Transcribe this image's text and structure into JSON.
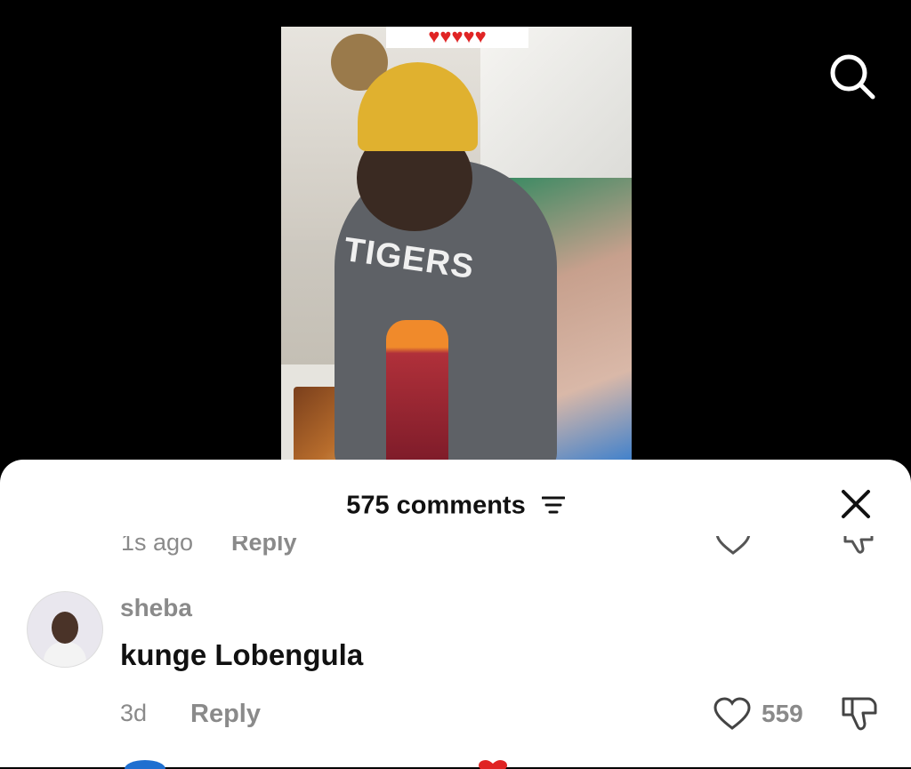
{
  "video": {
    "reaction_hearts": "♥♥♥♥♥",
    "hoodie_text": "TIGERS"
  },
  "sheet": {
    "comment_count": "575 comments"
  },
  "previous_comment": {
    "time": "1s ago",
    "reply_label": "Reply"
  },
  "comment": {
    "username": "sheba",
    "text": "kunge Lobengula",
    "time": "3d",
    "reply_label": "Reply",
    "likes": "559"
  },
  "icons": {
    "search": "search-icon",
    "sort": "sort-icon",
    "close": "close-icon",
    "like": "heart-icon",
    "dislike": "thumbs-down-icon"
  },
  "colors": {
    "sheet_bg": "#ffffff",
    "muted_text": "#8a8a8a",
    "primary_text": "#111111",
    "hearts": "#e02424"
  }
}
